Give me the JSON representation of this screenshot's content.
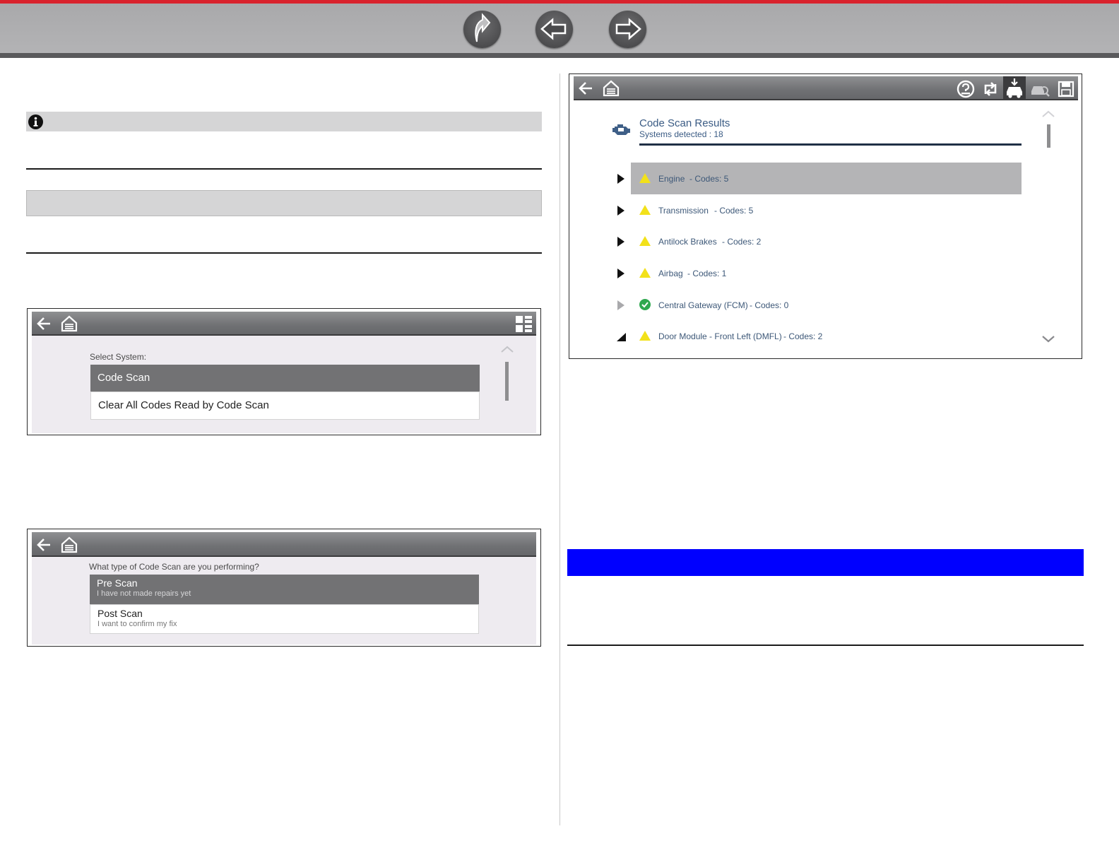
{
  "nav": {
    "buttons": [
      "up-arrow-icon",
      "back-arrow-icon",
      "forward-arrow-icon"
    ],
    "accent": "#d9232d"
  },
  "select_system": {
    "label": "Select System:",
    "items": [
      {
        "label": "Code Scan",
        "selected": true
      },
      {
        "label": "Clear All Codes Read by Code Scan",
        "selected": false
      }
    ]
  },
  "scan_type": {
    "question": "What type of Code Scan are you performing?",
    "items": [
      {
        "title": "Pre Scan",
        "subtitle": "I have not made repairs yet",
        "selected": true
      },
      {
        "title": "Post Scan",
        "subtitle": "I want to confirm my fix",
        "selected": false
      }
    ]
  },
  "results": {
    "title": "Code Scan Results",
    "subtitle": "Systems detected : 18",
    "rows": [
      {
        "system": "Engine",
        "codes": "- Codes: 5",
        "status": "warning",
        "expanded": false,
        "highlighted": true
      },
      {
        "system": "Transmission",
        "codes": "- Codes: 5",
        "status": "warning",
        "expanded": false,
        "highlighted": false
      },
      {
        "system": "Antilock Brakes",
        "codes": "- Codes: 2",
        "status": "warning",
        "expanded": false,
        "highlighted": false
      },
      {
        "system": "Airbag",
        "codes": "- Codes: 1",
        "status": "warning",
        "expanded": false,
        "highlighted": false
      },
      {
        "system": "Central Gateway (FCM)",
        "codes": "- Codes: 0",
        "status": "ok",
        "expanded": false,
        "highlighted": false
      },
      {
        "system": "Door Module - Front Left (DMFL)",
        "codes": "- Codes: 2",
        "status": "warning",
        "expanded": true,
        "highlighted": false
      }
    ],
    "warning_color": "#f2e11a",
    "ok_color": "#2fa84f"
  }
}
